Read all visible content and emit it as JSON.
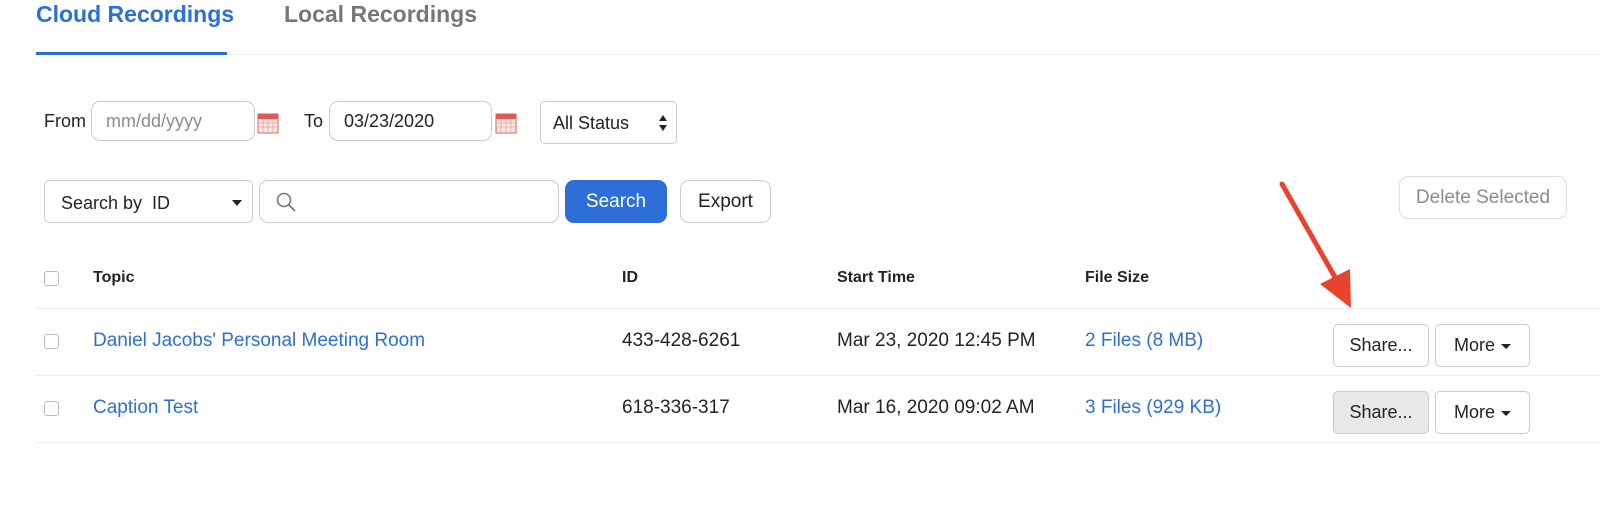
{
  "tabs": [
    {
      "label": "Cloud Recordings",
      "active": true
    },
    {
      "label": "Local Recordings",
      "active": false
    }
  ],
  "filters": {
    "from_label": "From",
    "from_placeholder": "mm/dd/yyyy",
    "from_value": "",
    "to_label": "To",
    "to_value": "03/23/2020",
    "status_value": "All Status",
    "calendar_icon": "calendar-icon"
  },
  "search": {
    "search_by_value": "Search by  ID",
    "query_value": "",
    "search_button": "Search",
    "export_button": "Export",
    "delete_selected_button": "Delete Selected"
  },
  "table": {
    "headers": {
      "topic": "Topic",
      "id": "ID",
      "start_time": "Start Time",
      "file_size": "File Size"
    },
    "rows": [
      {
        "topic": "Daniel Jacobs' Personal Meeting Room",
        "id": "433-428-6261",
        "start_time": "Mar 23, 2020 12:45 PM",
        "file_size": "2 Files (8 MB)",
        "share_label": "Share...",
        "more_label": "More"
      },
      {
        "topic": "Caption Test",
        "id": "618-336-317",
        "start_time": "Mar 16, 2020 09:02 AM",
        "file_size": "3 Files (929 KB)",
        "share_label": "Share...",
        "more_label": "More"
      }
    ]
  },
  "colors": {
    "accent": "#2d6fd6",
    "annotation_arrow": "#e8432e"
  }
}
